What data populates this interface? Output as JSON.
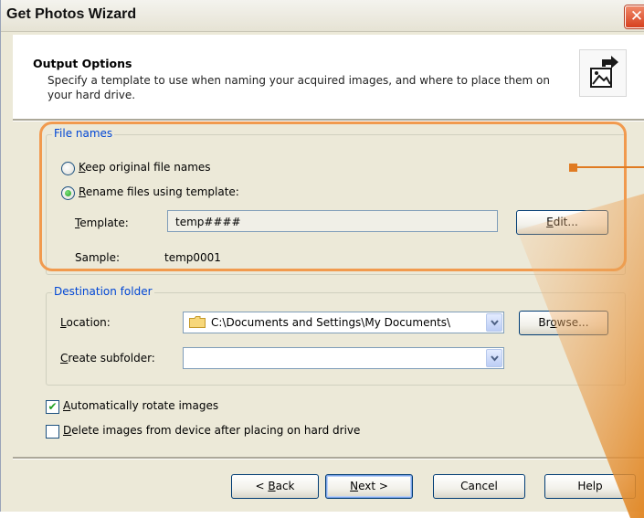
{
  "window": {
    "title": "Get Photos Wizard",
    "close_symbol": "✕"
  },
  "header": {
    "title": "Output Options",
    "description": "Specify a template to use when naming your acquired images, and where to place them on your hard drive.",
    "icon": "photo-export-icon"
  },
  "file_names": {
    "legend": "File names",
    "keep_original": {
      "accel": "K",
      "rest": "eep original file names",
      "checked": false
    },
    "rename_template": {
      "accel": "R",
      "rest": "ename files using template:",
      "checked": true
    },
    "template_label": {
      "accel": "T",
      "rest": "emplate:"
    },
    "template_value": "temp####",
    "edit_button": {
      "accel": "E",
      "rest": "dit..."
    },
    "sample_label": "Sample:",
    "sample_value": "temp0001"
  },
  "destination": {
    "legend": "Destination folder",
    "location_label": {
      "accel": "L",
      "rest": "ocation:"
    },
    "location_value": "C:\\Documents and Settings\\My Documents\\",
    "browse_button": {
      "pre": "Br",
      "accel": "o",
      "rest": "wse..."
    },
    "subfolder_label": {
      "accel": "C",
      "rest": "reate subfolder:"
    },
    "subfolder_value": ""
  },
  "options": {
    "auto_rotate": {
      "accel": "A",
      "rest": "utomatically rotate images",
      "checked": true,
      "mark": "✔"
    },
    "delete_after": {
      "accel": "D",
      "rest": "elete images from device after placing on hard drive",
      "checked": false
    }
  },
  "footer": {
    "back": {
      "pre": "< ",
      "accel": "B",
      "rest": "ack"
    },
    "next": {
      "accel": "N",
      "rest": "ext >"
    },
    "cancel": "Cancel",
    "help": "Help"
  },
  "colors": {
    "highlight": "#f19a4e",
    "legend_text": "#0046d5",
    "dialog_bg": "#ece9d8"
  }
}
